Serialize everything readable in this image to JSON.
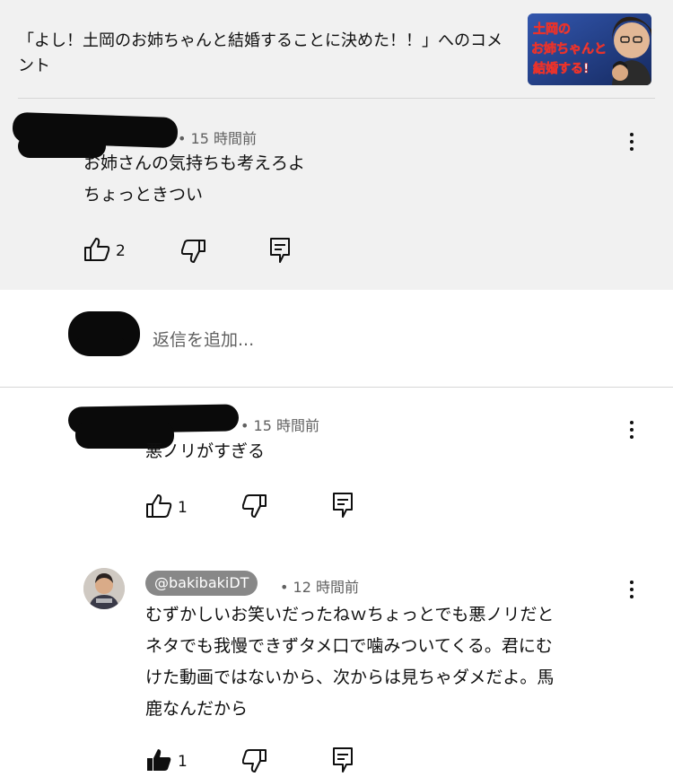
{
  "header": {
    "title": "「よし！土岡のお姉ちゃんと結婚することに決めた！！」へのコメント",
    "thumbnail_text": [
      "土岡の",
      "お姉ちゃんと",
      "結婚する!"
    ]
  },
  "main_comment": {
    "time": "• 15 時間前",
    "lines": [
      "お姉さんの気持ちも考えろよ",
      "ちょっときつい"
    ],
    "likes": "2"
  },
  "reply_input": {
    "placeholder": "返信を追加..."
  },
  "replies": [
    {
      "time": "• 15 時間前",
      "lines": [
        "悪ノリがすぎる"
      ],
      "likes": "1",
      "liked": false
    },
    {
      "handle": "@bakibakiDT",
      "time": "• 12 時間前",
      "lines": [
        "むずかしいお笑いだったねｗちょっとでも悪ノリだと",
        "ネタでも我慢できずタメ口で噛みついてくる。君にむ",
        "けた動画ではないから、次からは見ちゃダメだよ。馬",
        "鹿なんだから"
      ],
      "likes": "1",
      "liked": true
    }
  ],
  "colors": {
    "panel": "#f1f1f1",
    "text": "#0f0f0f",
    "meta": "#606060",
    "chip": "#888888",
    "thumb_bg": "#1e3f8c",
    "thumb_text": "#ffffff",
    "thumb_accent": "#e8322b"
  }
}
